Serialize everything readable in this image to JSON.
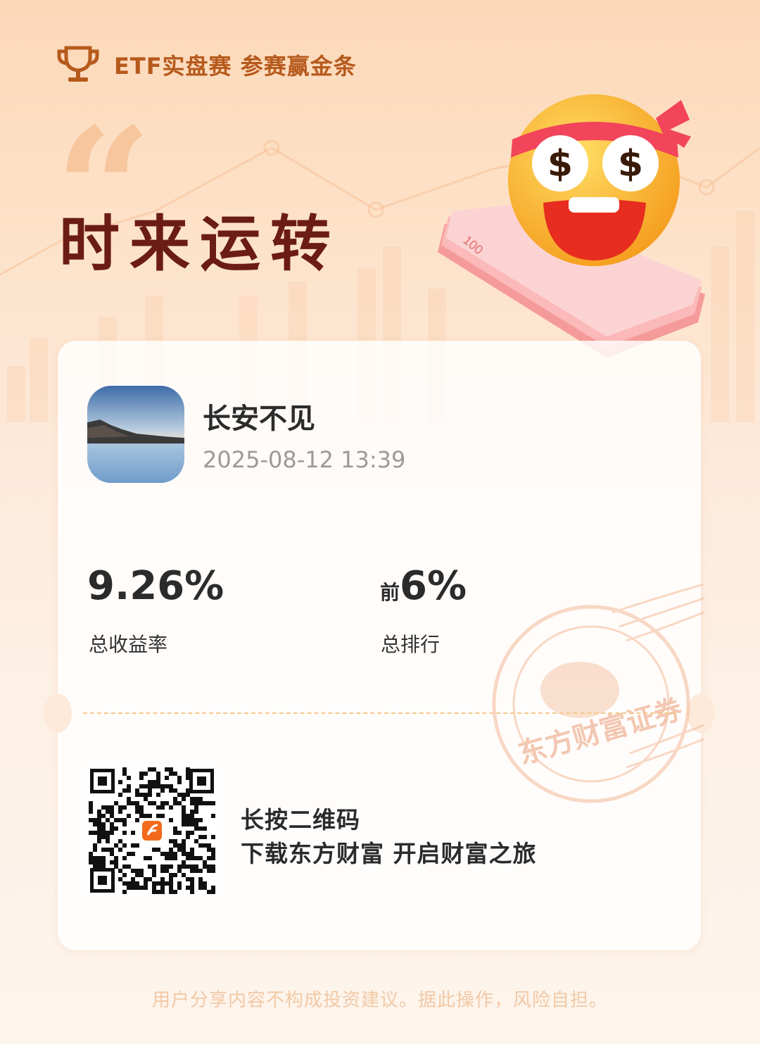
{
  "header": {
    "title": "ETF实盘赛 参赛赢金条",
    "icon": "trophy-icon",
    "accent_color": "#b65a1c"
  },
  "hero": {
    "quote_glyph": "“",
    "slogan": "时来运转",
    "slogan_color": "#6b1c16",
    "mascot_icon": "money-eyes-emoji",
    "banknote_text": "100"
  },
  "user": {
    "avatar": "landscape-avatar",
    "name": "长安不见",
    "timestamp": "2025-08-12 13:39"
  },
  "stats": {
    "return_value": "9.26%",
    "return_label": "总收益率",
    "rank_prefix": "前",
    "rank_value": "6%",
    "rank_label": "总排行"
  },
  "stamp": {
    "text": "东方财富证券",
    "color": "#f2b38e"
  },
  "qr": {
    "icon": "qr-code-icon",
    "line1": "长按二维码",
    "line2": "下载东方财富 开启财富之旅"
  },
  "footer": {
    "disclaimer": "用户分享内容不构成投资建议。据此操作，风险自担。"
  }
}
